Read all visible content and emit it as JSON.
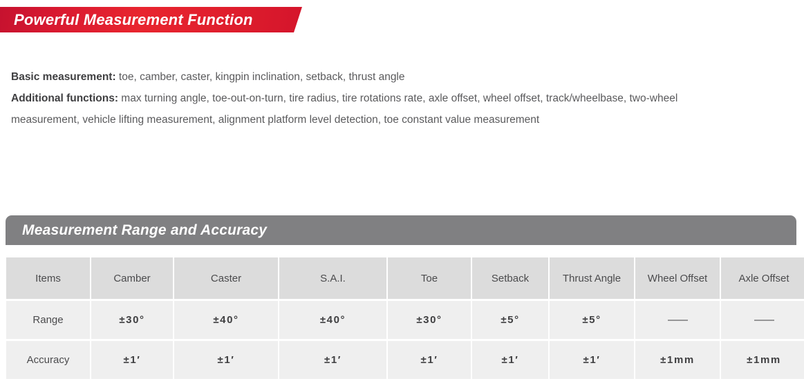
{
  "banner": {
    "title": "Powerful Measurement Function",
    "color": "#d81930",
    "text_color": "#ffffff"
  },
  "description": {
    "line1_lead": "Basic measurement:",
    "line1_text": " toe, camber, caster, kingpin inclination, setback, thrust angle",
    "line2_lead": "Additional functions:",
    "line2_text": " max turning angle, toe-out-on-turn, tire radius, tire rotations rate, axle offset, wheel offset, track/wheelbase, two-wheel measurement, vehicle lifting measurement, alignment platform level detection, toe constant value measurement"
  },
  "section": {
    "title": "Measurement Range and Accuracy",
    "bar_color": "#808082",
    "text_color": "#ffffff"
  },
  "table": {
    "header_bg": "#dcdcdc",
    "row_bg": "#efefef",
    "columns": [
      "Items",
      "Camber",
      "Caster",
      "S.A.I.",
      "Toe",
      "Setback",
      "Thrust Angle",
      "Wheel Offset",
      "Axle Offset"
    ],
    "rows": [
      {
        "label": "Range",
        "values": [
          "±30°",
          "±40°",
          "±40°",
          "±30°",
          "±5°",
          "±5°",
          "——",
          "——"
        ]
      },
      {
        "label": "Accuracy",
        "values": [
          "±1′",
          "±1′",
          "±1′",
          "±1′",
          "±1′",
          "±1′",
          "±1mm",
          "±1mm"
        ]
      }
    ]
  }
}
